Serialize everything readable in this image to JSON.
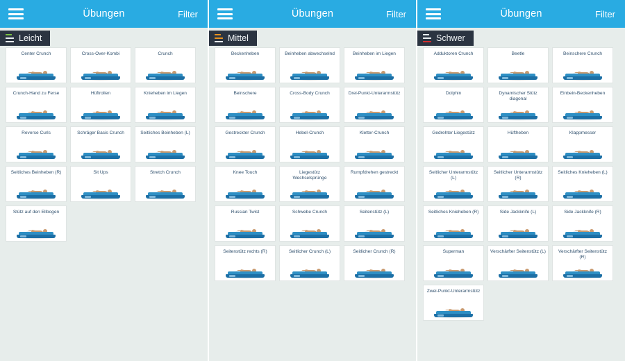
{
  "header": {
    "menu_icon": "hamburger-icon",
    "title": "Übungen",
    "filter_label": "Filter",
    "bar_color": "#29abe2"
  },
  "levels": [
    {
      "id": "leicht",
      "label": "Leicht",
      "accent_color": "#7ac143",
      "accent_bar": "top",
      "badge_bg": "#2b3441",
      "exercises": [
        "Center Crunch",
        "Cross-Over-Kombi",
        "Crunch",
        "Crunch-Hand zu Ferse",
        "Hüftrollen",
        "Knieheben im Liegen",
        "Reverse Curls",
        "Schräger Basis Crunch",
        "Seitliches Beinheben (L)",
        "Seitliches Beinheben (R)",
        "Sit Ups",
        "Stretch Crunch",
        "Stütz auf den Ellbogen"
      ]
    },
    {
      "id": "mittel",
      "label": "Mittel",
      "accent_color": "#e8921f",
      "accent_bar": "middle",
      "badge_bg": "#2b3441",
      "exercises": [
        "Beckenheben",
        "Beinheben abwechselnd",
        "Beinheben im Liegen",
        "Beinschere",
        "Cross-Body Crunch",
        "Drei-Punkt-Unterarmstütz",
        "Gestreckter Crunch",
        "Hebel-Crunch",
        "Kletter-Crunch",
        "Knee Touch",
        "Liegestütz Wechselsprünge",
        "Rumpfdrehen gestreckt",
        "Russian Twist",
        "Schwebe Crunch",
        "Seitenstütz (L)",
        "Seitenstütz rechts (R)",
        "Seitlicher Crunch (L)",
        "Seitlicher Crunch (R)"
      ]
    },
    {
      "id": "schwer",
      "label": "Schwer",
      "accent_color": "#d32f2f",
      "accent_bar": "bottom",
      "badge_bg": "#2b3441",
      "exercises": [
        "Adduktoren Crunch",
        "Beetle",
        "Beinschere Crunch",
        "Dolphin",
        "Dynamischer Stütz diagonal",
        "Einbein-Beckenheben",
        "Gedrehter Liegestütz",
        "Hüftheben",
        "Klappmesser",
        "Seitlicher Unterarmstütz (L)",
        "Seitlicher Unterarmstütz (R)",
        "Seitliches Knieheben (L)",
        "Seitliches Knieheben (R)",
        "Side Jackknife (L)",
        "Side Jackknife (R)",
        "Superman",
        "Verschärfter Seitenstütz (L)",
        "Verschärfter Seitenstütz (R)",
        "Zwei-Punkt-Unterarmstütz"
      ]
    }
  ]
}
